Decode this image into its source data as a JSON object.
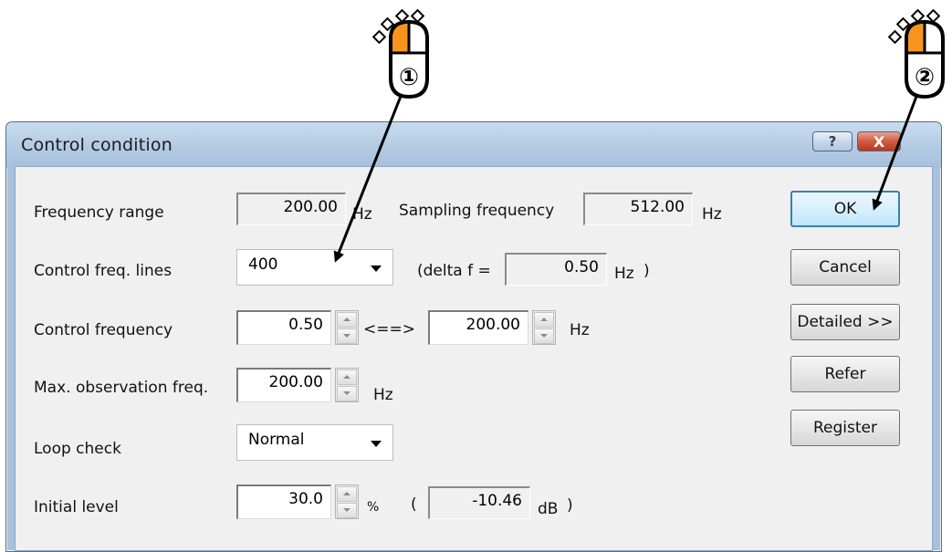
{
  "window": {
    "title": "Control condition",
    "help_glyph": "?",
    "close_glyph": "X"
  },
  "form": {
    "frequency_range": {
      "label": "Frequency range",
      "value": "200.00",
      "unit": "Hz"
    },
    "sampling_frequency": {
      "label": "Sampling frequency",
      "value": "512.00",
      "unit": "Hz"
    },
    "control_freq_lines": {
      "label": "Control freq. lines",
      "value": "400"
    },
    "delta_f": {
      "prefix": "(delta f =",
      "value": "0.50",
      "unit": "Hz",
      "suffix": ")"
    },
    "control_frequency": {
      "label": "Control frequency",
      "from": "0.50",
      "separator": "<==>",
      "to": "200.00",
      "unit": "Hz"
    },
    "max_observation_freq": {
      "label": "Max. observation freq.",
      "value": "200.00",
      "unit": "Hz"
    },
    "loop_check": {
      "label": "Loop check",
      "value": "Normal"
    },
    "initial_level": {
      "label": "Initial level",
      "value": "30.0",
      "unit": "%",
      "paren_open": "(",
      "db_value": "-10.46",
      "db_unit": "dB",
      "paren_close": ")"
    }
  },
  "buttons": {
    "ok": "OK",
    "cancel": "Cancel",
    "detailed": "Detailed >>",
    "refer": "Refer",
    "register": "Register"
  },
  "annotations": {
    "step1": "①",
    "step2": "②",
    "mouse_icon": "mouse-left-click-icon",
    "highlight_color": "#f7941d"
  }
}
